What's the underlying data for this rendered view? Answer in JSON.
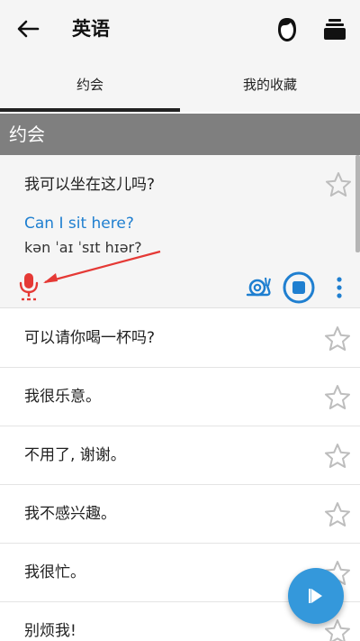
{
  "appbar": {
    "title": "英语",
    "icons": [
      "back-arrow-icon",
      "avatar-icon",
      "stack-icon"
    ]
  },
  "tabs": [
    {
      "label": "约会",
      "selected": true
    },
    {
      "label": "我的收藏",
      "selected": false
    }
  ],
  "section": {
    "title": "约会"
  },
  "expanded_phrase": {
    "chinese": "我可以坐在这儿吗?",
    "english": "Can I sit here?",
    "phonetic": "kən ˈaɪ ˈsɪt hɪər?",
    "starred": false,
    "icons": [
      "microphone-icon",
      "snail-icon",
      "stop-icon",
      "more-vert-icon",
      "star-outline-icon"
    ],
    "accent_color": "#1f7fd0",
    "mic_color": "#e53935"
  },
  "phrases": [
    {
      "chinese": "可以请你喝一杯吗?",
      "starred": false
    },
    {
      "chinese": "我很乐意。",
      "starred": false
    },
    {
      "chinese": "不用了, 谢谢。",
      "starred": false
    },
    {
      "chinese": "我不感兴趣。",
      "starred": false
    },
    {
      "chinese": "我很忙。",
      "starred": false
    },
    {
      "chinese": "别烦我!",
      "starred": false
    }
  ],
  "fab": {
    "icon": "play-icon",
    "color": "#3498db"
  }
}
